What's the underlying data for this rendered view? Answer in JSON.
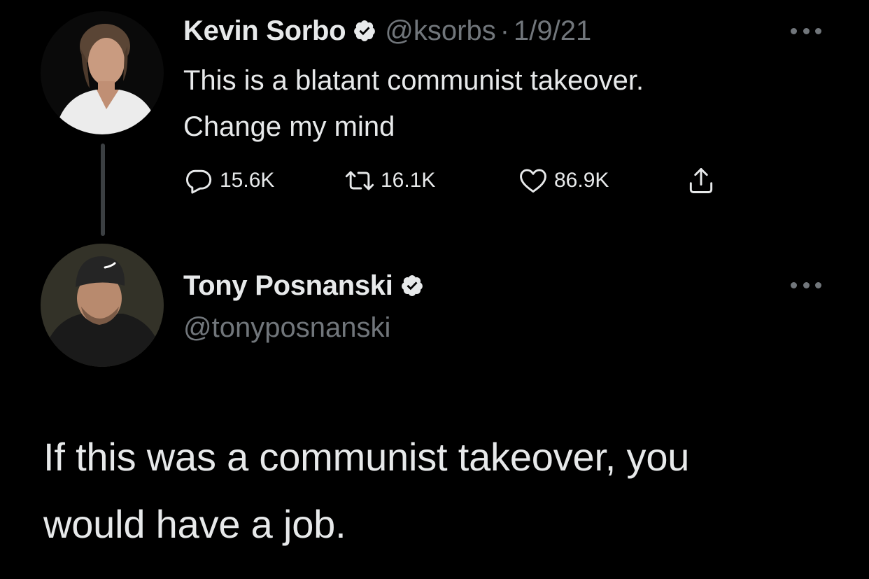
{
  "colors": {
    "background": "#000000",
    "primary_text": "#e7e9ea",
    "secondary_text": "#71767b",
    "verified_badge": "#e7e9ea",
    "thread_line": "#3b3f42"
  },
  "tweet": {
    "author": {
      "name": "Kevin Sorbo",
      "verified_icon": "verified-badge-icon",
      "handle": "@ksorbs",
      "separator": "·",
      "date": "1/9/21"
    },
    "text_line1": "This is a blatant communist takeover.",
    "text_line2": "Change my mind",
    "actions": {
      "reply": {
        "icon": "reply-icon",
        "count": "15.6K"
      },
      "retweet": {
        "icon": "retweet-icon",
        "count": "16.1K"
      },
      "like": {
        "icon": "heart-icon",
        "count": "86.9K"
      },
      "share": {
        "icon": "share-icon"
      }
    },
    "more_icon": "more-options-icon"
  },
  "reply": {
    "author": {
      "name": "Tony Posnanski",
      "verified_icon": "verified-badge-icon",
      "handle": "@tonyposnanski"
    },
    "text_line1": "If this was a communist takeover, you",
    "text_line2": "would have a job.",
    "more_icon": "more-options-icon"
  }
}
